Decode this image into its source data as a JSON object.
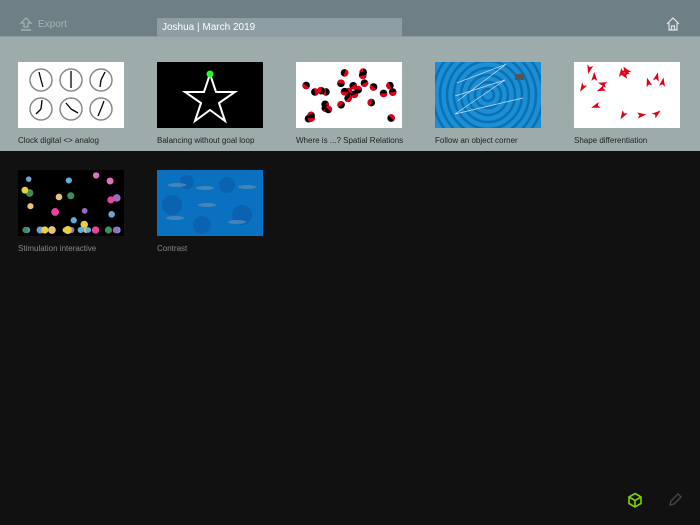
{
  "header": {
    "export_label": "Export",
    "title": "Joshua | March 2019"
  },
  "exercises": [
    {
      "label": "Clock digital <> analog"
    },
    {
      "label": "Balancing without goal loop"
    },
    {
      "label": "Where is ...? Spatial Relations"
    },
    {
      "label": "Follow an object corner"
    },
    {
      "label": "Shape differentiation"
    },
    {
      "label": "Stimulation interactive"
    },
    {
      "label": "Contrast"
    }
  ],
  "colors": {
    "accent": "#7fd300",
    "header": "#6f7f86",
    "band": "#9dabab",
    "background": "#111111"
  }
}
